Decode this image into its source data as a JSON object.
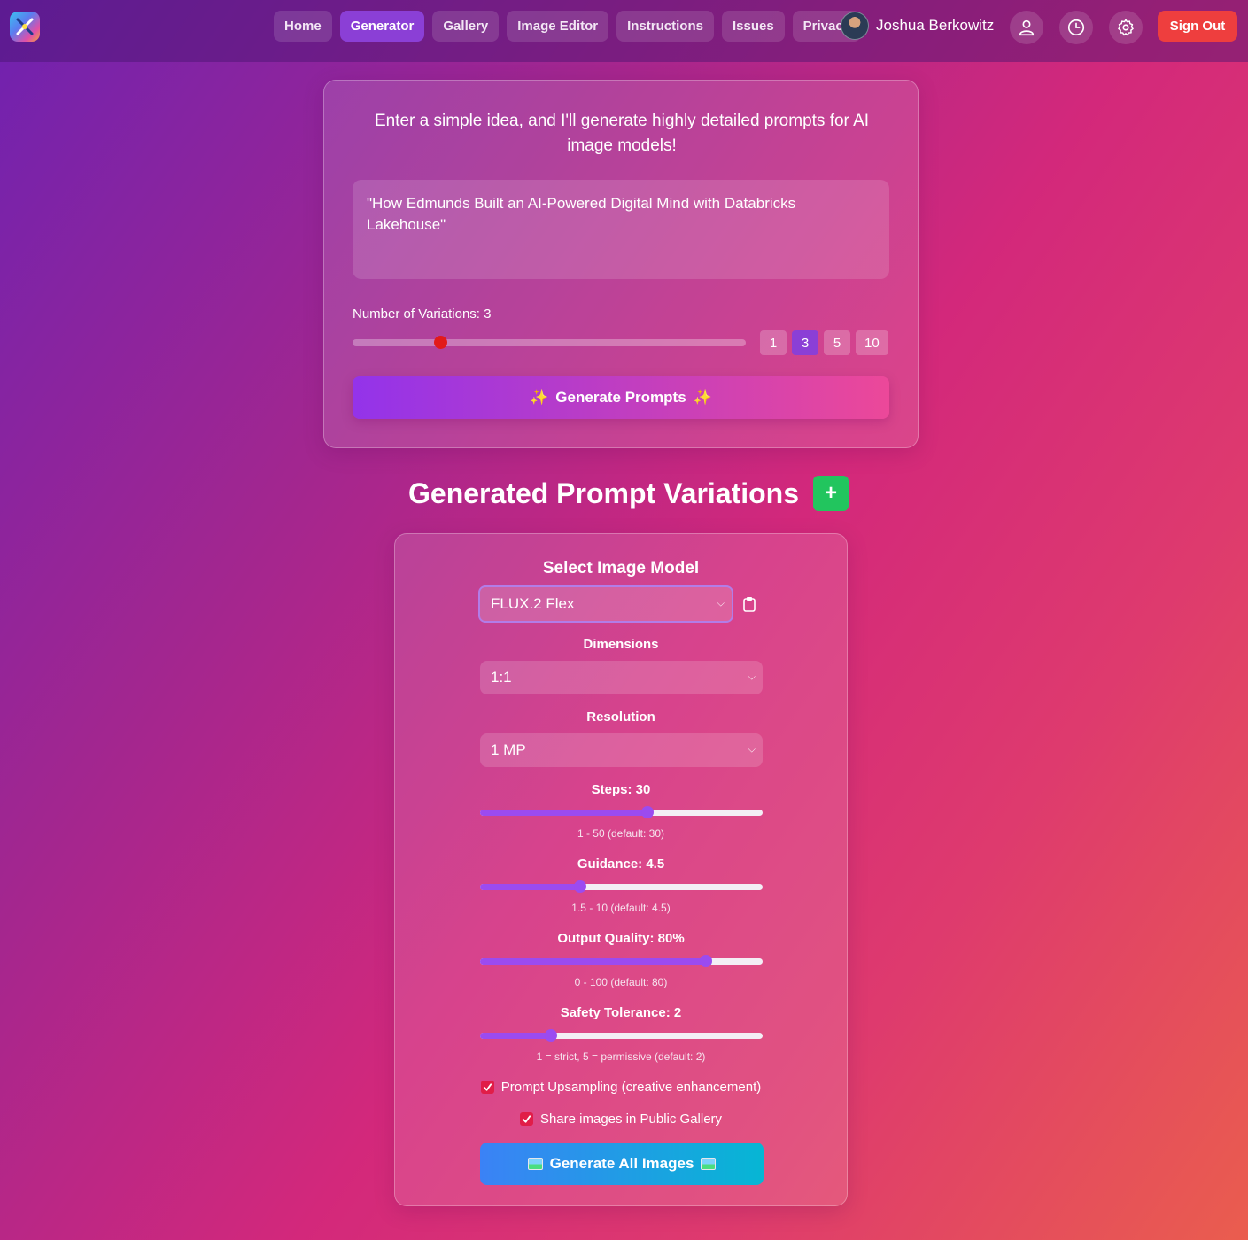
{
  "nav": {
    "links": [
      "Home",
      "Generator",
      "Gallery",
      "Image Editor",
      "Instructions",
      "Issues",
      "Privacy"
    ],
    "active": "Generator",
    "user_name": "Joshua Berkowitz",
    "signout_label": "Sign Out"
  },
  "generator": {
    "intro": "Enter a simple idea, and I'll generate highly detailed prompts for AI image models!",
    "idea_text": "\"How Edmunds Built an AI-Powered Digital Mind with Databricks Lakehouse\"",
    "variations_label": "Number of Variations: 3",
    "variations_value": 3,
    "variations_min": 1,
    "variations_max": 10,
    "presets": [
      "1",
      "3",
      "5",
      "10"
    ],
    "active_preset": "3",
    "button_label": "Generate Prompts"
  },
  "variations": {
    "heading": "Generated Prompt Variations",
    "add_label": "+"
  },
  "settings": {
    "title": "Select Image Model",
    "model": "FLUX.2 Flex",
    "dimensions_label": "Dimensions",
    "dimensions": "1:1",
    "resolution_label": "Resolution",
    "resolution": "1 MP",
    "steps": {
      "label": "Steps: 30",
      "hint": "1 - 50 (default: 30)",
      "value": 30,
      "min": 1,
      "max": 50
    },
    "guidance": {
      "label": "Guidance: 4.5",
      "hint": "1.5 - 10 (default: 4.5)",
      "value": 4.5,
      "min": 1.5,
      "max": 10
    },
    "quality": {
      "label": "Output Quality: 80%",
      "hint": "0 - 100 (default: 80)",
      "value": 80,
      "min": 0,
      "max": 100
    },
    "safety": {
      "label": "Safety Tolerance: 2",
      "hint": "1 = strict, 5 = permissive (default: 2)",
      "value": 2,
      "min": 1,
      "max": 5
    },
    "upsampling_label": "Prompt Upsampling (creative enhancement)",
    "upsampling_checked": true,
    "share_label": "Share images in Public Gallery",
    "share_checked": true,
    "generate_all_label": "Generate All Images"
  },
  "colors": {
    "active_nav": "#8b3fd6",
    "signout": "#ee3e3e",
    "add_button": "#22c55e",
    "slider": "#9b4bf0",
    "checkbox": "#e11d48"
  }
}
